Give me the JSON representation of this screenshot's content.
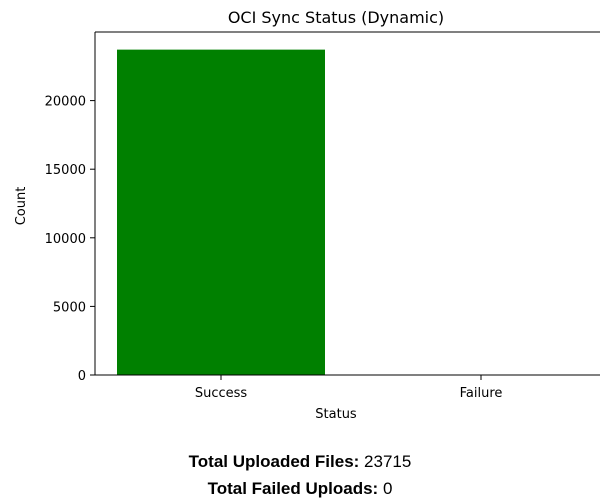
{
  "chart_data": {
    "type": "bar",
    "title": "OCI Sync Status (Dynamic)",
    "xlabel": "Status",
    "ylabel": "Count",
    "categories": [
      "Success",
      "Failure"
    ],
    "values": [
      23715,
      0
    ],
    "ylim": [
      0,
      25000
    ],
    "yticks": [
      0,
      5000,
      10000,
      15000,
      20000
    ],
    "bar_color": "#008000",
    "grid": false,
    "legend": "none"
  },
  "summary": {
    "uploaded_label": "Total Uploaded Files:",
    "uploaded_value": "23715",
    "failed_label": "Total Failed Uploads:",
    "failed_value": "0"
  }
}
